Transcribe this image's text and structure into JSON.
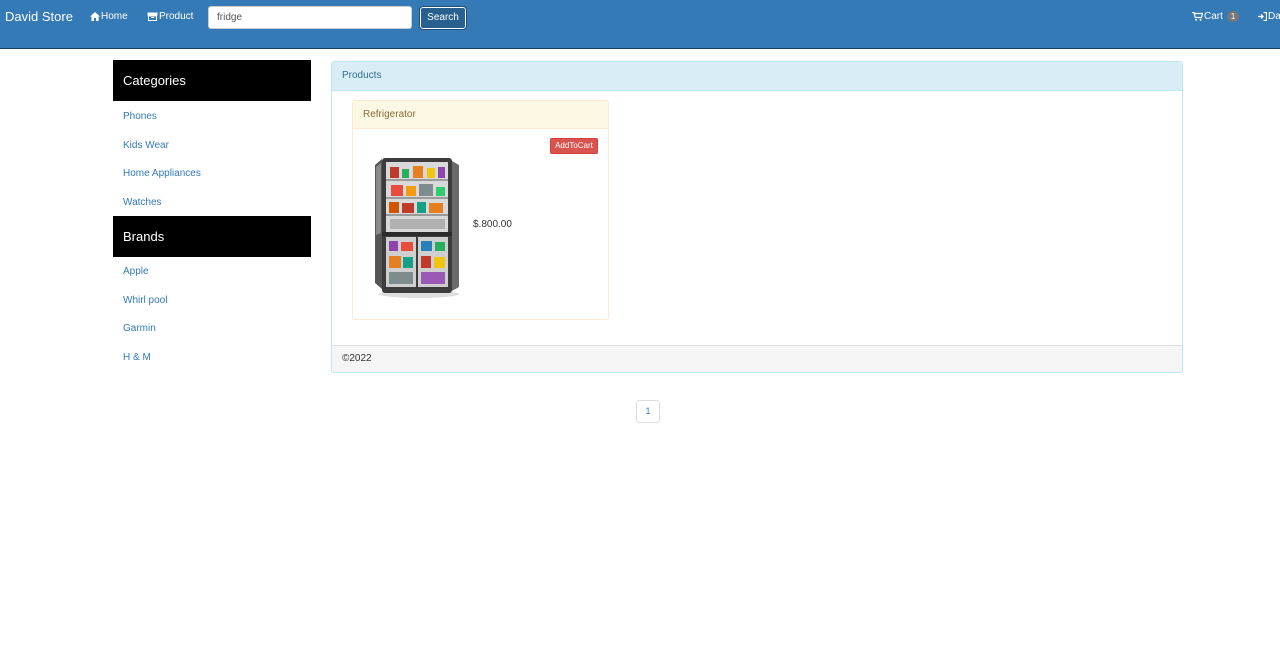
{
  "navbar": {
    "brand": "David Store",
    "home_label": "Home",
    "product_label": "Product",
    "search_value": "fridge",
    "search_button": "Search",
    "cart_label": "Cart",
    "cart_count": "1",
    "login_label": "Da"
  },
  "sidebar": {
    "categories_title": "Categories",
    "categories": [
      "Phones",
      "Kids Wear",
      "Home Appliances",
      "Watches"
    ],
    "brands_title": "Brands",
    "brands": [
      "Apple",
      "Whirl pool",
      "Garmin",
      "H & M"
    ]
  },
  "products": {
    "title": "Products",
    "items": [
      {
        "name": "Refrigerator",
        "add_label": "AddToCart",
        "price": "$.800.00"
      }
    ],
    "footer": "©2022"
  },
  "pagination": {
    "pages": [
      "1"
    ]
  },
  "colors": {
    "navbar": "#337ab7",
    "add_button": "#d9534f",
    "link": "#337ab7"
  }
}
